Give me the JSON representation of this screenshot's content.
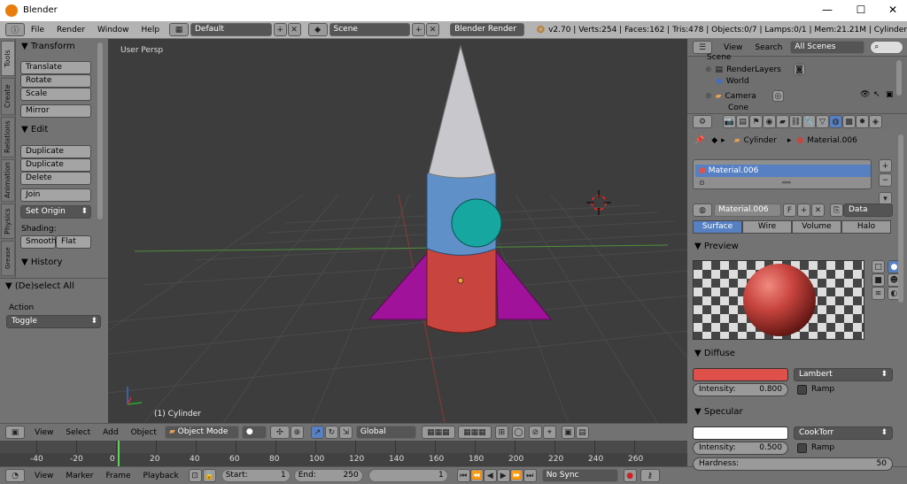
{
  "window": {
    "title": "Blender",
    "minimize": "—",
    "maximize": "☐",
    "close": "✕"
  },
  "info_header": {
    "menus": [
      "File",
      "Render",
      "Window",
      "Help"
    ],
    "screen_layout": "Default",
    "scene": "Scene",
    "render_engine": "Blender Render",
    "stats": "v2.70 | Verts:254 | Faces:162 | Tris:478 | Objects:0/7 | Lamps:0/1 | Mem:21.21M | Cylinder"
  },
  "tool_tabs": [
    "Tools",
    "Create",
    "Relations",
    "Animation",
    "Physics",
    "Grease Pencil"
  ],
  "toolshelf": {
    "transform_title": "Transform",
    "translate": "Translate",
    "rotate": "Rotate",
    "scale": "Scale",
    "mirror": "Mirror",
    "edit_title": "Edit",
    "duplicate": "Duplicate",
    "duplicate_linked": "Duplicate Linked",
    "delete": "Delete",
    "join": "Join",
    "set_origin": "Set Origin",
    "shading_label": "Shading:",
    "smooth": "Smooth",
    "flat": "Flat",
    "history_title": "History"
  },
  "operator_panel": {
    "title": "(De)select All",
    "action_label": "Action",
    "action_value": "Toggle"
  },
  "viewport": {
    "view_label": "User Persp",
    "object_label": "(1) Cylinder"
  },
  "viewport_header": {
    "menus": [
      "View",
      "Select",
      "Add",
      "Object"
    ],
    "mode": "Object Mode",
    "orientation": "Global"
  },
  "timeline": {
    "ticks": [
      "-40",
      "-20",
      "0",
      "20",
      "40",
      "60",
      "80",
      "100",
      "120",
      "140",
      "160",
      "180",
      "200",
      "220",
      "240",
      "260"
    ],
    "current_frame": "1"
  },
  "timeline_header": {
    "menus": [
      "View",
      "Marker",
      "Frame",
      "Playback"
    ],
    "start_label": "Start:",
    "start": "1",
    "end_label": "End:",
    "end": "250",
    "frame": "1",
    "sync": "No Sync"
  },
  "outliner": {
    "menus": [
      "View",
      "Search"
    ],
    "filter": "All Scenes",
    "items": [
      "Scene",
      "RenderLayers",
      "World",
      "Camera",
      "Cone"
    ]
  },
  "properties": {
    "breadcrumb_object": "Cylinder",
    "breadcrumb_material": "Material.006",
    "slot": "Material.006",
    "material_name": "Material.006",
    "f_label": "F",
    "link": "Data",
    "tabs": [
      "Surface",
      "Wire",
      "Volume",
      "Halo"
    ],
    "preview_title": "Preview",
    "diffuse_title": "Diffuse",
    "diffuse_color": "#e0504a",
    "diffuse_shader": "Lambert",
    "diffuse_intensity_label": "Intensity:",
    "diffuse_intensity": "0.800",
    "ramp": "Ramp",
    "specular_title": "Specular",
    "specular_color": "#ffffff",
    "specular_shader": "CookTorr",
    "specular_intensity_label": "Intensity:",
    "specular_intensity": "0.500",
    "specular_ramp": "Ramp",
    "hardness_label": "Hardness:",
    "hardness": "50"
  },
  "colors": {
    "selection_blue": "#5680c2",
    "rocket_red": "#c8443e",
    "rocket_blue": "#5f91c8",
    "fins_magenta": "#a0129a",
    "cone_gray": "#c8c8cc",
    "window_teal": "#16a8a0"
  }
}
